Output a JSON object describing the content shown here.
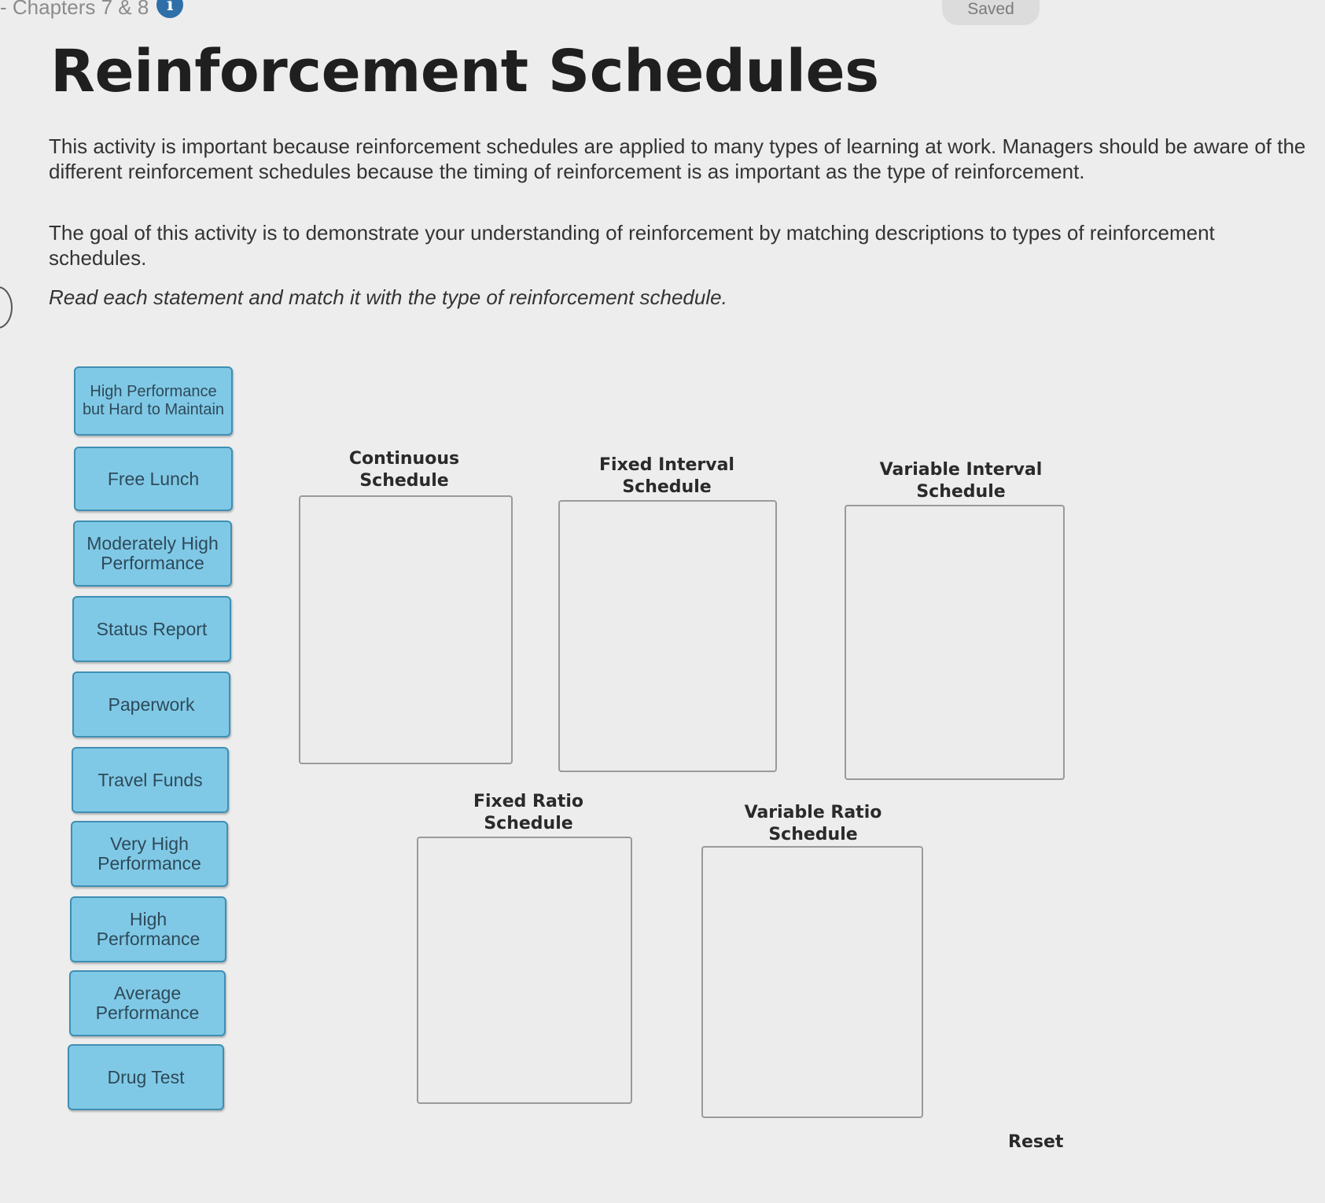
{
  "header": {
    "breadcrumb": "- Chapters 7 & 8",
    "info_icon": "info-icon",
    "saved_label": "Saved"
  },
  "title": "Reinforcement Schedules",
  "paragraphs": {
    "importance": "This activity is important because reinforcement schedules are applied to many types of learning at work. Managers should be aware of the different reinforcement schedules because the timing of reinforcement is as important as the type of reinforcement.",
    "goal": "The goal of this activity is to demonstrate your understanding of reinforcement by matching descriptions to types of reinforcement schedules.",
    "instruction": "Read each statement and match it with the type of reinforcement schedule."
  },
  "chips": [
    "High Performance but Hard to Maintain",
    "Free Lunch",
    "Moderately High Performance",
    "Status Report",
    "Paperwork",
    "Travel Funds",
    "Very High Performance",
    "High Performance",
    "Average Performance",
    "Drug Test"
  ],
  "zones": {
    "continuous": "Continuous Schedule",
    "fixed_interval": "Fixed Interval Schedule",
    "variable_interval": "Variable Interval Schedule",
    "fixed_ratio": "Fixed Ratio Schedule",
    "variable_ratio": "Variable Ratio Schedule"
  },
  "reset_label": "Reset",
  "colors": {
    "chip_fill": "#80c9e6",
    "chip_border": "#3e8fb3",
    "info_icon": "#2f6fa8"
  }
}
